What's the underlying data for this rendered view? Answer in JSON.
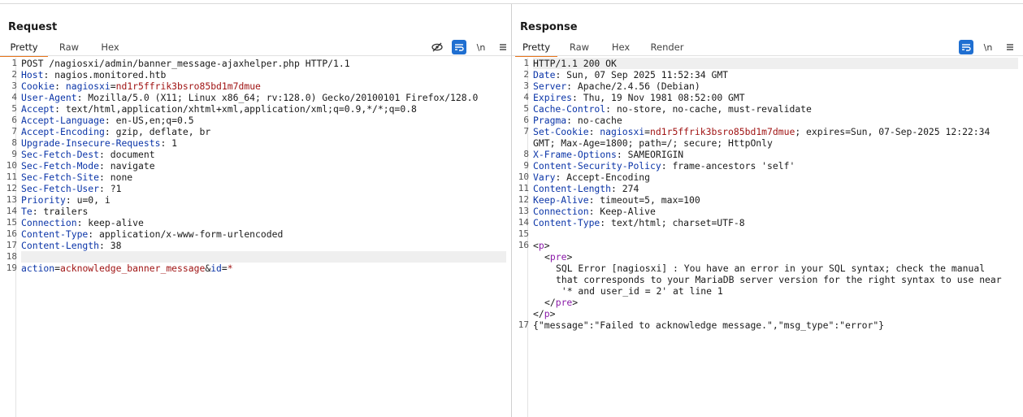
{
  "request": {
    "title": "Request",
    "tabs": [
      "Pretty",
      "Raw",
      "Hex"
    ],
    "active_tab": "Pretty",
    "tools": [
      "eye-slash-icon",
      "wrap-icon",
      "newline-icon",
      "menu-icon"
    ],
    "newline_label": "\\n",
    "lines": [
      {
        "n": "1",
        "text": "POST /nagiosxi/admin/banner_message-ajaxhelper.php HTTP/1.1"
      },
      {
        "n": "2",
        "key": "Host",
        "value": " nagios.monitored.htb"
      },
      {
        "n": "3",
        "key": "Cookie",
        "value": " ",
        "ck_name": "nagiosxi",
        "ck_val": "nd1r5ffrik3bsro85bd1m7dmue"
      },
      {
        "n": "4",
        "key": "User-Agent",
        "value": " Mozilla/5.0 (X11; Linux x86_64; rv:128.0) Gecko/20100101 Firefox/128.0"
      },
      {
        "n": "5",
        "key": "Accept",
        "value": " text/html,application/xhtml+xml,application/xml;q=0.9,*/*;q=0.8"
      },
      {
        "n": "6",
        "key": "Accept-Language",
        "value": " en-US,en;q=0.5"
      },
      {
        "n": "7",
        "key": "Accept-Encoding",
        "value": " gzip, deflate, br"
      },
      {
        "n": "8",
        "key": "Upgrade-Insecure-Requests",
        "value": " 1"
      },
      {
        "n": "9",
        "key": "Sec-Fetch-Dest",
        "value": " document"
      },
      {
        "n": "10",
        "key": "Sec-Fetch-Mode",
        "value": " navigate"
      },
      {
        "n": "11",
        "key": "Sec-Fetch-Site",
        "value": " none"
      },
      {
        "n": "12",
        "key": "Sec-Fetch-User",
        "value": " ?1"
      },
      {
        "n": "13",
        "key": "Priority",
        "value": " u=0, i"
      },
      {
        "n": "14",
        "key": "Te",
        "value": " trailers"
      },
      {
        "n": "15",
        "key": "Connection",
        "value": " keep-alive"
      },
      {
        "n": "16",
        "key": "Content-Type",
        "value": " application/x-www-form-urlencoded"
      },
      {
        "n": "17",
        "key": "Content-Length",
        "value": " 38"
      },
      {
        "n": "18",
        "text": ""
      },
      {
        "n": "19",
        "body": true,
        "p1": "action",
        "v1": "acknowledge_banner_message",
        "p2": "id",
        "v2": "*"
      }
    ]
  },
  "response": {
    "title": "Response",
    "tabs": [
      "Pretty",
      "Raw",
      "Hex",
      "Render"
    ],
    "active_tab": "Pretty",
    "tools": [
      "wrap-icon",
      "newline-icon",
      "menu-icon"
    ],
    "newline_label": "\\n",
    "lines": [
      {
        "n": "1",
        "text": "HTTP/1.1 200 OK"
      },
      {
        "n": "2",
        "key": "Date",
        "value": " Sun, 07 Sep 2025 11:52:34 GMT"
      },
      {
        "n": "3",
        "key": "Server",
        "value": " Apache/2.4.56 (Debian)"
      },
      {
        "n": "4",
        "key": "Expires",
        "value": " Thu, 19 Nov 1981 08:52:00 GMT"
      },
      {
        "n": "5",
        "key": "Cache-Control",
        "value": " no-store, no-cache, must-revalidate"
      },
      {
        "n": "6",
        "key": "Pragma",
        "value": " no-cache"
      },
      {
        "n": "7",
        "key": "Set-Cookie",
        "value": " ",
        "ck_name": "nagiosxi",
        "ck_val": "nd1r5ffrik3bsro85bd1m7dmue",
        "rest": "; expires=Sun, 07-Sep-2025 12:22:34"
      },
      {
        "n": "",
        "text": "GMT; Max-Age=1800; path=/; secure; HttpOnly"
      },
      {
        "n": "8",
        "key": "X-Frame-Options",
        "value": " SAMEORIGIN"
      },
      {
        "n": "9",
        "key": "Content-Security-Policy",
        "value": " frame-ancestors 'self'"
      },
      {
        "n": "10",
        "key": "Vary",
        "value": " Accept-Encoding"
      },
      {
        "n": "11",
        "key": "Content-Length",
        "value": " 274"
      },
      {
        "n": "12",
        "key": "Keep-Alive",
        "value": " timeout=5, max=100"
      },
      {
        "n": "13",
        "key": "Connection",
        "value": " Keep-Alive"
      },
      {
        "n": "14",
        "key": "Content-Type",
        "value": " text/html; charset=UTF-8"
      },
      {
        "n": "15",
        "text": ""
      },
      {
        "n": "16",
        "tag": "p",
        "open": true,
        "indent": 0
      },
      {
        "n": "",
        "tag": "pre",
        "open": true,
        "indent": 1
      },
      {
        "n": "",
        "text": "SQL Error [nagiosxi] : You have an error in your SQL syntax; check the manual",
        "indent": 2
      },
      {
        "n": "",
        "text": "that corresponds to your MariaDB server version for the right syntax to use near",
        "indent": 2
      },
      {
        "n": "",
        "text": " '* and user_id = 2' at line 1",
        "indent": 2
      },
      {
        "n": "",
        "tag": "pre",
        "open": false,
        "indent": 1
      },
      {
        "n": "",
        "tag": "p",
        "open": false,
        "indent": 0
      },
      {
        "n": "17",
        "text": "{\"message\":\"Failed to acknowledge message.\",\"msg_type\":\"error\"}"
      }
    ]
  },
  "layout_buttons": [
    "split-horizontal-icon",
    "split-vertical-icon",
    "single-pane-icon"
  ]
}
